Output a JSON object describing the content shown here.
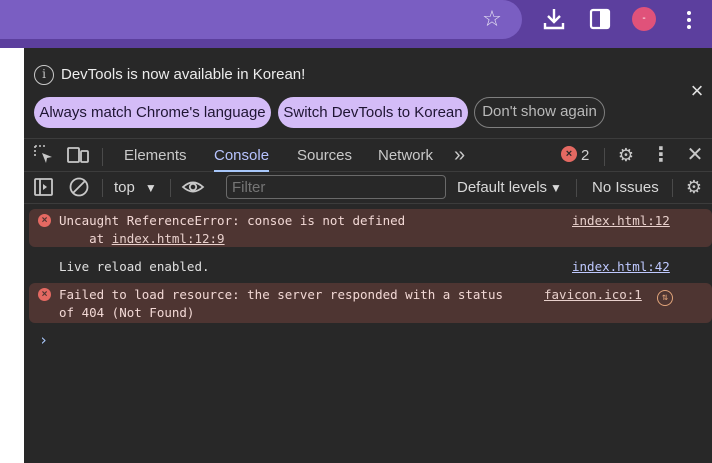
{
  "browser": {
    "profile_initial": "-",
    "colors": {
      "frame": "#5c3f9e",
      "omnibox": "#7a5ec2",
      "profile": "#e0527a"
    }
  },
  "infobar": {
    "message": "DevTools is now available in Korean!",
    "buttons": {
      "match_language": "Always match Chrome's language",
      "switch_korean": "Switch DevTools to Korean",
      "dont_show": "Don't show again"
    }
  },
  "tabs": {
    "elements": "Elements",
    "console": "Console",
    "sources": "Sources",
    "network": "Network",
    "more": "»",
    "active": "Console"
  },
  "error_badge": {
    "count": "2"
  },
  "console_toolbar": {
    "context": "top",
    "filter_placeholder": "Filter",
    "levels": "Default levels",
    "issues": "No Issues"
  },
  "messages": [
    {
      "type": "error",
      "text": "Uncaught ReferenceError: consoe is not defined",
      "stack_prefix": "    at ",
      "stack_link": "index.html:12:9",
      "source": "index.html:12"
    },
    {
      "type": "log",
      "text": "Live reload enabled.",
      "source": "index.html:42"
    },
    {
      "type": "error",
      "text": "Failed to load resource: the server responded with a status",
      "text_line2": "of 404 (Not Found)",
      "source": "favicon.ico:1"
    }
  ],
  "console_prompt": "›"
}
